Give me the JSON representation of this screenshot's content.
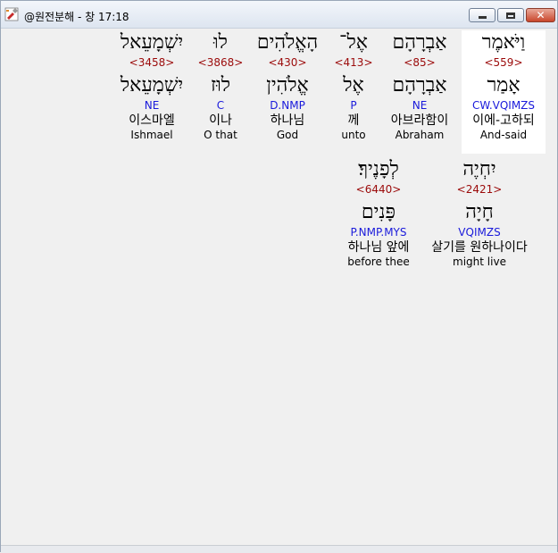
{
  "window": {
    "title": "@원전분해 - 창 17:18",
    "app_icon": "tools-icon",
    "buttons": {
      "minimize": "minimize-icon",
      "maximize": "maximize-icon",
      "close": "✕"
    }
  },
  "words": [
    {
      "heb": "וַיֹּאמֶר",
      "strong": "<559>",
      "lemma": "אָמַר",
      "parse": "CW.VQIMZS",
      "korean": "이에-고하되",
      "english": "And-said",
      "selected": true
    },
    {
      "heb": "אַבְרָהָם",
      "strong": "<85>",
      "lemma": "אַבְרָהָם",
      "parse": "NE",
      "korean": "아브라함이",
      "english": "Abraham",
      "selected": false
    },
    {
      "heb": "אֶל־",
      "strong": "<413>",
      "lemma": "אֶל",
      "parse": "P",
      "korean": "께",
      "english": "unto",
      "selected": false
    },
    {
      "heb": "הָאֱלֹהִים",
      "strong": "<430>",
      "lemma": "אֱלֹהִין",
      "parse": "D.NMP",
      "korean": "하나님",
      "english": "God",
      "selected": false
    },
    {
      "heb": "לוּ",
      "strong": "<3868>",
      "lemma": "לוּז",
      "parse": "C",
      "korean": "이나",
      "english": "O that",
      "selected": false
    },
    {
      "heb": "יִשְׁמָעֵאל",
      "strong": "<3458>",
      "lemma": "יִשְׁמָעֵאל",
      "parse": "NE",
      "korean": "이스마엘",
      "english": "Ishmael",
      "selected": false
    },
    {
      "heb": "יִחְיֶה",
      "strong": "<2421>",
      "lemma": "חָיָה",
      "parse": "VQIMZS",
      "korean": "살기를 원하나이다",
      "english": "might live",
      "selected": false
    },
    {
      "heb": "לְפָנֶיךָ׃",
      "strong": "<6440>",
      "lemma": "פָּנִים",
      "parse": "P.NMP.MYS",
      "korean": "하나님 앞에",
      "english": "before thee",
      "selected": false
    }
  ]
}
